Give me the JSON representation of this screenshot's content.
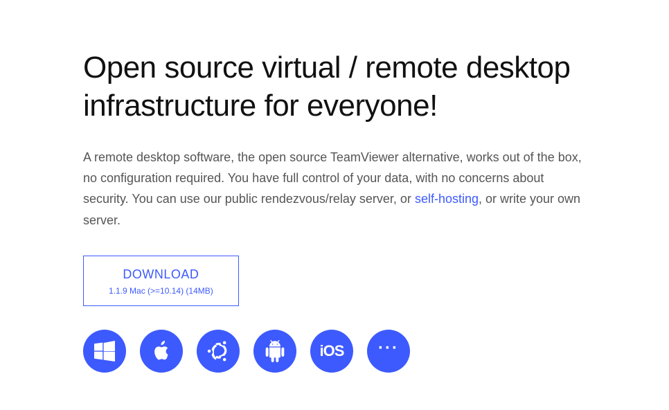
{
  "heading": "Open source virtual / remote desktop infrastructure for everyone!",
  "description": {
    "part1": "A remote desktop software, the open source TeamViewer alternative, works out of the box, no configuration required. You have full control of your data, with no concerns about security. You can use our public rendezvous/relay server, or ",
    "link": "self-hosting",
    "part2": ", or write your own server."
  },
  "download": {
    "title": "DOWNLOAD",
    "subtitle": "1.1.9 Mac (>=10.14) (14MB)"
  },
  "platforms": {
    "ios_label": "iOS",
    "more_label": "···"
  }
}
